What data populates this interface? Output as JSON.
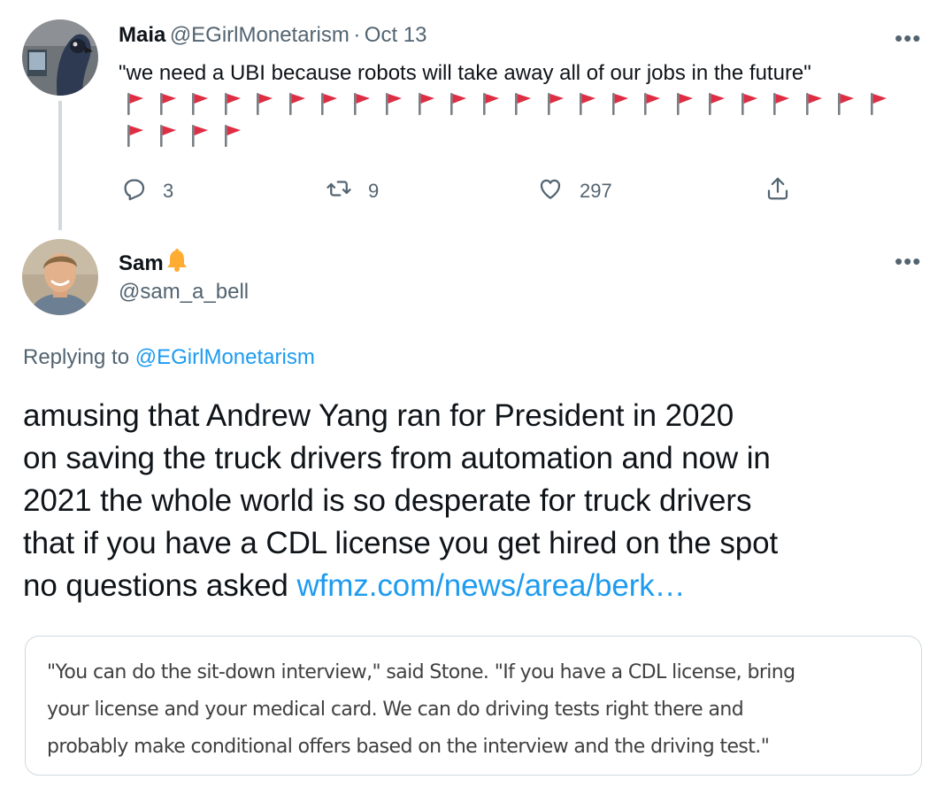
{
  "parent_tweet": {
    "name": "Maia",
    "handle": "@EGirlMonetarism",
    "separator": "·",
    "date": "Oct 13",
    "text": "\"we need a UBI because robots will take away all of our jobs in the future\"",
    "flag_emoji": "🚩",
    "flag_count": 28,
    "more_label": "•••",
    "actions": {
      "reply_count": "3",
      "retweet_count": "9",
      "like_count": "297"
    },
    "icons": [
      "reply-icon",
      "retweet-icon",
      "like-icon",
      "share-icon"
    ]
  },
  "main_tweet": {
    "name": "Sam",
    "name_emoji": "🔔",
    "handle": "@sam_a_bell",
    "more_label": "•••",
    "replying_prefix": "Replying to",
    "replying_handle": "@EGirlMonetarism",
    "text_lines": [
      "amusing that Andrew Yang ran for President in 2020",
      "on saving the truck drivers from automation and now in",
      "2021 the whole world is so desperate for truck drivers",
      "that if you have a CDL license you get hired on the spot",
      "no questions asked"
    ],
    "link_text": "wfmz.com/news/area/berk…",
    "card": {
      "lines": [
        "\"You can do the sit-down interview,\" said Stone. \"If you have a CDL license, bring",
        "your license and your medical card. We can do driving tests right there and",
        "probably make conditional offers based on the interview and the driving test.\""
      ]
    }
  },
  "colors": {
    "accent": "#1d9bf0",
    "secondary_text": "#536471",
    "primary_text": "#0f1419",
    "border": "#cfd9de",
    "flag_red": "#dd2e44",
    "bell_yellow": "#ffac33"
  }
}
